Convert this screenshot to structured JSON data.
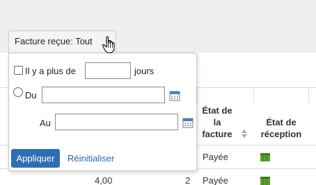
{
  "filter": {
    "button_label": "Facture reçue: Tout",
    "options": {
      "more_than_prefix": "Il y a plus de",
      "more_than_value": "",
      "more_than_suffix": "jours",
      "from_label": "Du",
      "from_value": "",
      "to_label": "Au",
      "to_value": ""
    },
    "apply_label": "Appliquer",
    "reset_label": "Réinitialiser"
  },
  "table": {
    "headers": {
      "invoice_state_lines": [
        "État de",
        "la",
        "facture"
      ],
      "reception_state_lines": [
        "État de",
        "réception"
      ]
    },
    "rows": [
      {
        "amount": "",
        "qty": "",
        "invoice_state": "Payée",
        "reception_icon": "reception-status-icon"
      },
      {
        "amount": "4,00",
        "qty": "2",
        "invoice_state": "Payée",
        "reception_icon": "reception-status-icon"
      }
    ]
  },
  "colors": {
    "accent": "#2f6eb5",
    "link": "#2a62a8",
    "status_green": "#5aa02c"
  }
}
